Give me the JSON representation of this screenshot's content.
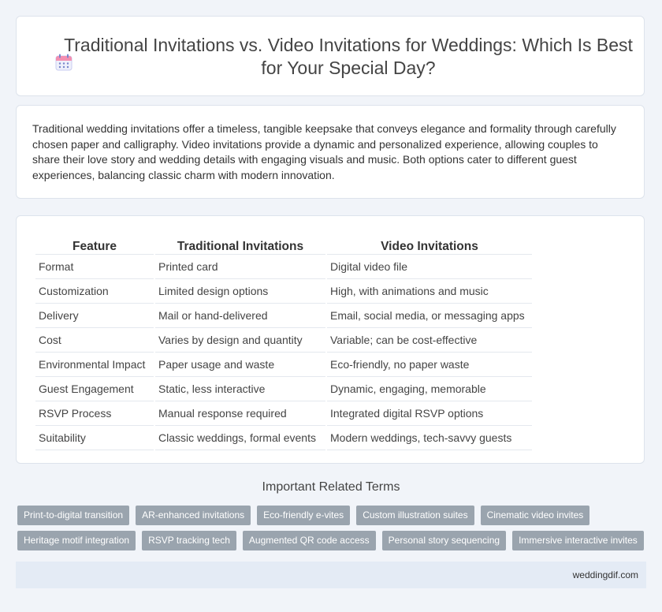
{
  "header": {
    "icon": "calendar-icon",
    "title": "Traditional Invitations vs. Video Invitations for Weddings: Which Is Best for Your Special Day?"
  },
  "summary": {
    "text": "Traditional wedding invitations offer a timeless, tangible keepsake that conveys elegance and formality through carefully chosen paper and calligraphy. Video invitations provide a dynamic and personalized experience, allowing couples to share their love story and wedding details with engaging visuals and music. Both options cater to different guest experiences, balancing classic charm with modern innovation."
  },
  "table": {
    "headers": [
      "Feature",
      "Traditional Invitations",
      "Video Invitations"
    ],
    "rows": [
      [
        "Format",
        "Printed card",
        "Digital video file"
      ],
      [
        "Customization",
        "Limited design options",
        "High, with animations and music"
      ],
      [
        "Delivery",
        "Mail or hand-delivered",
        "Email, social media, or messaging apps"
      ],
      [
        "Cost",
        "Varies by design and quantity",
        "Variable; can be cost-effective"
      ],
      [
        "Environmental Impact",
        "Paper usage and waste",
        "Eco-friendly, no paper waste"
      ],
      [
        "Guest Engagement",
        "Static, less interactive",
        "Dynamic, engaging, memorable"
      ],
      [
        "RSVP Process",
        "Manual response required",
        "Integrated digital RSVP options"
      ],
      [
        "Suitability",
        "Classic weddings, formal events",
        "Modern weddings, tech-savvy guests"
      ]
    ]
  },
  "related": {
    "title": "Important Related Terms",
    "rows": [
      [
        "Print-to-digital transition",
        "AR-enhanced invitations",
        "Eco-friendly e-vites",
        "Custom illustration suites",
        "Cinematic video invites"
      ],
      [
        "Heritage motif integration",
        "RSVP tracking tech",
        "Augmented QR code access",
        "Personal story sequencing",
        "Immersive interactive invites"
      ]
    ]
  },
  "footer": {
    "site": "weddingdif.com"
  }
}
